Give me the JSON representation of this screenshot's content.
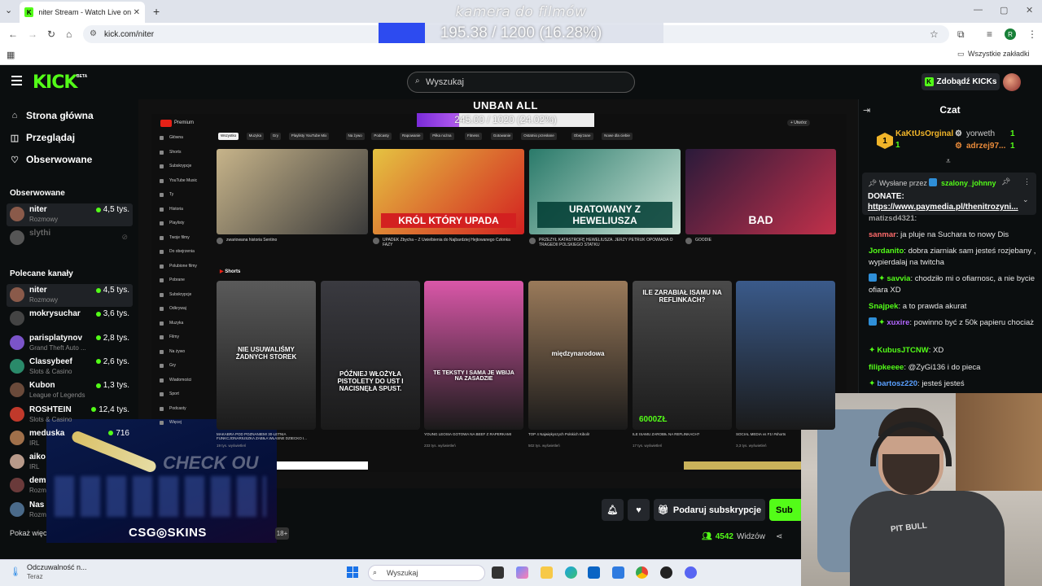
{
  "browser": {
    "tab_title": "niter Stream - Watch Live on Kick",
    "tab_favicon": "K",
    "url": "kick.com/niter",
    "bookmarks_label": "Wszystkie zakładki",
    "profile_initial": "R"
  },
  "overlay_top": {
    "title": "kamera do filmów",
    "progress_text": "195.38 / 1200 (16.28%)",
    "progress": 0.1628,
    "colors": {
      "fill": "#2d4bf0"
    }
  },
  "overlay_goal": {
    "title": "UNBAN ALL",
    "progress_text": "245.00 / 1020 (24.02%)",
    "progress": 0.2402
  },
  "header": {
    "logo": "KICK",
    "beta": "BETA",
    "search_placeholder": "Wyszukaj",
    "get_kicks": "Zdobądź KICKs"
  },
  "sidebar": {
    "nav": [
      {
        "label": "Strona główna",
        "icon": "home-icon"
      },
      {
        "label": "Przeglądaj",
        "icon": "browse-icon"
      },
      {
        "label": "Obserwowane",
        "icon": "heart-icon"
      }
    ],
    "followed_title": "Obserwowane",
    "followed": [
      {
        "name": "niter",
        "category": "Rozmowy",
        "viewers": "4,5 tys.",
        "live": true,
        "avatar": "#8a5a4a"
      },
      {
        "name": "slythi",
        "category": "",
        "viewers": "",
        "live": false,
        "avatar": "#555"
      }
    ],
    "recommended_title": "Polecane kanały",
    "recommended": [
      {
        "name": "niter",
        "category": "Rozmowy",
        "viewers": "4,5 tys.",
        "avatar": "#8a5a4a"
      },
      {
        "name": "mokrysuchar",
        "category": "",
        "viewers": "3,6 tys.",
        "avatar": "#444"
      },
      {
        "name": "parisplatynov",
        "category": "Grand Theft Auto ...",
        "viewers": "2,8 tys.",
        "avatar": "#7b54c9"
      },
      {
        "name": "Classybeef",
        "category": "Slots & Casino",
        "viewers": "2,6 tys.",
        "avatar": "#2a8a6a"
      },
      {
        "name": "Kubon",
        "category": "League of Legends",
        "viewers": "1,3 tys.",
        "avatar": "#6a4a3a"
      },
      {
        "name": "ROSHTEIN",
        "category": "Slots & Casino",
        "viewers": "12,4 tys.",
        "avatar": "#c0392b"
      },
      {
        "name": "meduska",
        "category": "IRL",
        "viewers": "716",
        "avatar": "#a0704a"
      },
      {
        "name": "aiko",
        "category": "IRL",
        "viewers": "",
        "avatar": "#b89a8a"
      },
      {
        "name": "dem",
        "category": "Rozm",
        "viewers": "",
        "avatar": "#6a3a3a"
      },
      {
        "name": "Nas",
        "category": "Rozm",
        "viewers": "",
        "avatar": "#4a6a8a"
      }
    ],
    "show_more": "Pokaż więc"
  },
  "video_content": {
    "yt_logo": "Premium",
    "chips": [
      "Wszystko",
      "Muzyka",
      "Gry",
      "Playlisty YouTube Mix",
      "Na żywo",
      "Podcasty",
      "Rapowanie",
      "Piłka nożna",
      "Fitness",
      "Gotowanie",
      "Ostatnio przesłane",
      "Obejrzane",
      "Nowe dla ciebie"
    ],
    "side_items": [
      "Główna",
      "Shorts",
      "Subskrypcje",
      "YouTube Music",
      "Ty",
      "Historia",
      "Playlisty",
      "Twoje filmy",
      "Do obejrzenia",
      "Polubione filmy",
      "Pobrane",
      "Subskrypcje",
      "Odkrywaj",
      "Muzyka",
      "Filmy",
      "Na żywo",
      "Gry",
      "Wiadomości",
      "Sport",
      "Podcasty",
      "Więcej"
    ],
    "thumbs": [
      {
        "caption": "",
        "title": "zwariowana historia Sentino",
        "color1": "#c7b48a",
        "color2": "#3a3a3a"
      },
      {
        "caption": "KRÓL KTÓRY UPADA",
        "title": "UPADEK Zbycha – Z Uwielbienia do Najbardziej Hejtowanego Członka FAZY",
        "color1": "#e5c341",
        "color2": "#d32020"
      },
      {
        "caption": "URATOWANY Z HEWELIUSZA",
        "title": "PRZEŻYŁ KATASTROFĘ HEWELIUSZA. JERZY PETRUK OPOWIADA O TRAGEDII POLSKIEGO STATKU",
        "color1": "#2a7a6a",
        "color2": "#cfe6da"
      },
      {
        "caption": "BAD",
        "title": "GOODIE",
        "color1": "#2a1a3a",
        "color2": "#c2304a"
      }
    ],
    "shorts_label": "Shorts",
    "shorts": [
      {
        "caption": "NIE USUWALIŚMY ŻADNYCH STOREK",
        "title": "MAKABRA POD POZNANIEM! 30-LETNIA FUNKCJONARIUSZKA ZABIŁA WŁASNE DZIECKO I...",
        "meta": "19 tys. wyświetleń",
        "color": "#5a5a5a"
      },
      {
        "caption": "PÓŹNIEJ WŁOŻYŁA PISTOLETY DO UST I NACISNĘŁA SPUST.",
        "title": "",
        "meta": "",
        "color": "#3a3a40"
      },
      {
        "caption": "TE TEKSTY I SAMA JE WBIJA NA ZASADZIE",
        "title": "YOUNG LEOSIA GOTOWA NA BEEF Z RAPERKAMI",
        "meta": "233 tys. wyświetleń",
        "color": "#d957a8"
      },
      {
        "caption": "międzynarodowa",
        "title": "TOP 4 Najwiękyszych Polskich Kiboli!",
        "meta": "502 tys. wyświetleń",
        "color": "#9a7a5a"
      },
      {
        "caption": "ILE ZARABIAŁ ISAMU NA REFLINKACH?",
        "title": "ILE ISAMU ZAROBIŁ NA REFLINKACH?",
        "meta": "17 tys. wyświetleń",
        "color": "#4a4a4a"
      },
      {
        "caption": "",
        "title": "SOCIAL MEDIA vs F1! #shorts",
        "meta": "3,3 tys. wyświetleń",
        "color": "#3a5a8a"
      }
    ]
  },
  "promo": {
    "check": "CHECK OU",
    "brand": "CSG◎SKINS"
  },
  "stream_actions": {
    "gift_sub": "Podaruj subskrypcje",
    "subscribe": "Sub",
    "viewers_count": "4542",
    "viewers_label": "Widzów",
    "age_badge": "18+"
  },
  "chat": {
    "title": "Czat",
    "top_gifters": [
      {
        "name": "KaKtUsOrginal",
        "count": "1"
      },
      {
        "name": "yorweth",
        "count": "1"
      },
      {
        "name": "adrzej97...",
        "count": "1"
      }
    ],
    "pinned": {
      "sent_by_prefix": "Wysłane przez",
      "sent_by_user": "szalony_johnny",
      "label": "DONATE:",
      "link": "https://www.paymedia.pl/thenitrozyni..."
    },
    "messages": [
      {
        "user": "matizsd4321",
        "text": "",
        "color": "#a0a0a0",
        "badges": ""
      },
      {
        "user": "sanmar",
        "text": "ja pluje na Suchara to nowy Dis",
        "color": "#ff6b6b",
        "badges": ""
      },
      {
        "user": "Jordanito",
        "text": "dobra ziarniak sam jesteś rozjebany , wypierdalaj na twitcha",
        "color": "#53fc18",
        "badges": ""
      },
      {
        "user": "savvia",
        "text": "chodziło mi o ofiarnosc, a nie bycie ofiara XD",
        "color": "#53fc18",
        "badges": "bg"
      },
      {
        "user": "Snajpek",
        "text": "a to prawda akurat",
        "color": "#53fc18",
        "badges": ""
      },
      {
        "user": "xuxire",
        "text": "powinno być z 50k papieru chociaż",
        "color": "#b266ff",
        "badges": "bg"
      },
      {
        "user": "KubusJTCNW",
        "text": "XD",
        "color": "#53fc18",
        "badges": "g"
      },
      {
        "user": "filipkeeee",
        "text": "@ZyGi136 i do pieca",
        "color": "#53fc18",
        "badges": ""
      },
      {
        "user": "bartosz220",
        "text": "jesteś jesteś",
        "color": "#5aa0ff",
        "badges": "g"
      }
    ]
  },
  "webcam": {
    "shirt_text": "PIT BULL"
  },
  "taskbar": {
    "notif_title": "Odczuwalność n...",
    "notif_sub": "Teraz",
    "search_placeholder": "Wyszukaj"
  }
}
